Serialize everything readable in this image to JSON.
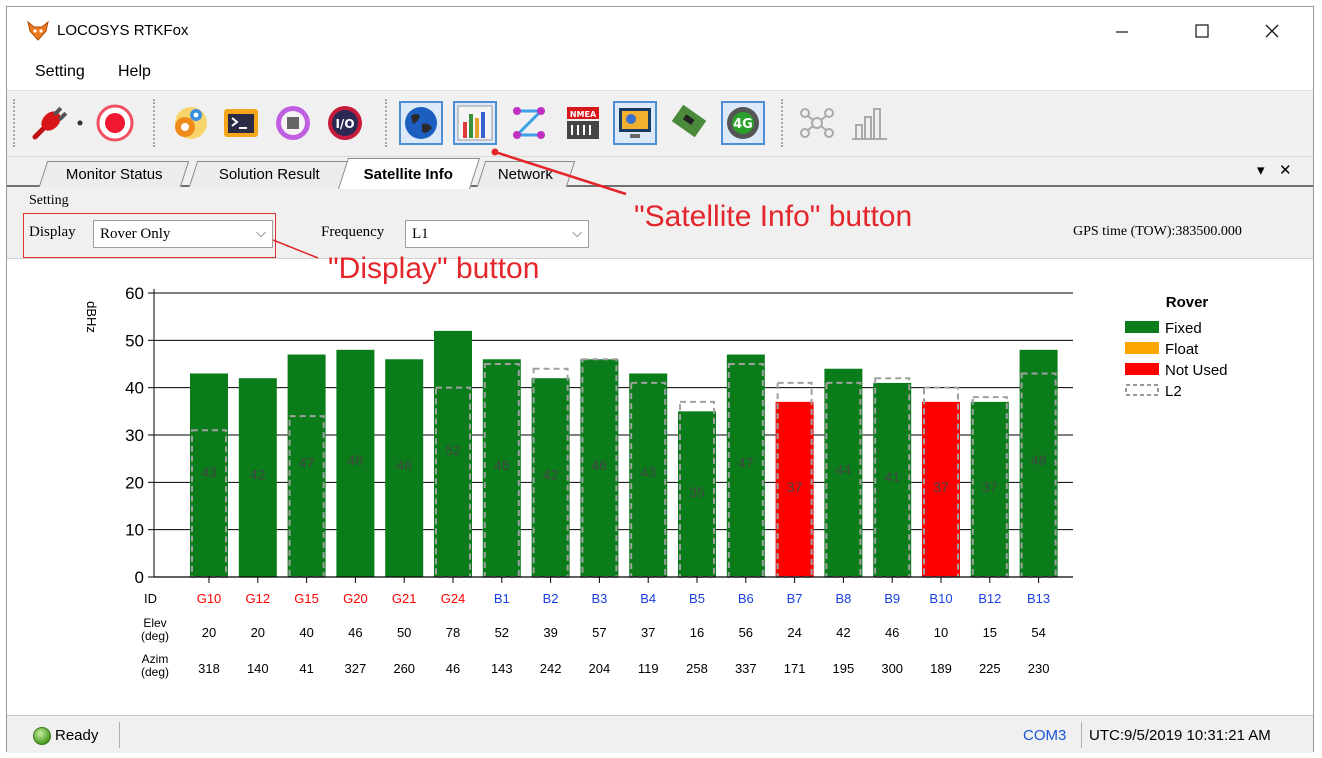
{
  "window": {
    "title": "LOCOSYS RTKFox"
  },
  "menu": [
    "Setting",
    "Help"
  ],
  "tabs": [
    {
      "label": "Monitor Status",
      "active": false
    },
    {
      "label": "Solution Result",
      "active": false
    },
    {
      "label": "Satellite Info",
      "active": true
    },
    {
      "label": "Network",
      "active": false
    }
  ],
  "setting": {
    "group_label": "Setting",
    "display_label": "Display",
    "display_value": "Rover Only",
    "frequency_label": "Frequency",
    "frequency_value": "L1",
    "gps_time": "GPS time (TOW):383500.000"
  },
  "annotations": {
    "satellite_info": "\"Satellite Info\" button",
    "display": "\"Display\" button"
  },
  "status": {
    "ready": "Ready",
    "com": "COM3",
    "utc": "UTC:9/5/2019 10:31:21 AM"
  },
  "colors": {
    "fixed": "#0a7d1a",
    "float": "#ffa500",
    "not_used": "#ff0000",
    "gps_id": "#ff0000",
    "bds_id": "#1a3fe0",
    "annotation": "#e4262b"
  },
  "chart_data": {
    "type": "bar",
    "ylabel": "dBHz",
    "ylim": [
      0,
      60
    ],
    "yticks": [
      0,
      10,
      20,
      30,
      40,
      50,
      60
    ],
    "grid": true,
    "legend": {
      "title": "Rover",
      "placement": "right",
      "entries": [
        "Fixed",
        "Float",
        "Not Used",
        "L2"
      ]
    },
    "row_labels": {
      "id": "ID",
      "elev": "Elev\n(deg)",
      "azim": "Azim\n(deg)"
    },
    "satellites": [
      {
        "id": "G10",
        "system": "GPS",
        "snr": 43,
        "l2": 31,
        "status": "Fixed",
        "elev": 20,
        "azim": 318
      },
      {
        "id": "G12",
        "system": "GPS",
        "snr": 42,
        "l2": null,
        "status": "Fixed",
        "elev": 20,
        "azim": 140
      },
      {
        "id": "G15",
        "system": "GPS",
        "snr": 47,
        "l2": 34,
        "status": "Fixed",
        "elev": 40,
        "azim": 41
      },
      {
        "id": "G20",
        "system": "GPS",
        "snr": 48,
        "l2": null,
        "status": "Fixed",
        "elev": 46,
        "azim": 327
      },
      {
        "id": "G21",
        "system": "GPS",
        "snr": 46,
        "l2": null,
        "status": "Fixed",
        "elev": 50,
        "azim": 260
      },
      {
        "id": "G24",
        "system": "GPS",
        "snr": 52,
        "l2": 40,
        "status": "Fixed",
        "elev": 78,
        "azim": 46
      },
      {
        "id": "B1",
        "system": "BDS",
        "snr": 46,
        "l2": 45,
        "status": "Fixed",
        "elev": 52,
        "azim": 143
      },
      {
        "id": "B2",
        "system": "BDS",
        "snr": 42,
        "l2": 44,
        "status": "Fixed",
        "elev": 39,
        "azim": 242
      },
      {
        "id": "B3",
        "system": "BDS",
        "snr": 46,
        "l2": 46,
        "status": "Fixed",
        "elev": 57,
        "azim": 204
      },
      {
        "id": "B4",
        "system": "BDS",
        "snr": 43,
        "l2": 41,
        "status": "Fixed",
        "elev": 37,
        "azim": 119
      },
      {
        "id": "B5",
        "system": "BDS",
        "snr": 35,
        "l2": 37,
        "status": "Fixed",
        "elev": 16,
        "azim": 258
      },
      {
        "id": "B6",
        "system": "BDS",
        "snr": 47,
        "l2": 45,
        "status": "Fixed",
        "elev": 56,
        "azim": 337
      },
      {
        "id": "B7",
        "system": "BDS",
        "snr": 37,
        "l2": 41,
        "status": "Not Used",
        "elev": 24,
        "azim": 171
      },
      {
        "id": "B8",
        "system": "BDS",
        "snr": 44,
        "l2": 41,
        "status": "Fixed",
        "elev": 42,
        "azim": 195
      },
      {
        "id": "B9",
        "system": "BDS",
        "snr": 41,
        "l2": 42,
        "status": "Fixed",
        "elev": 46,
        "azim": 300
      },
      {
        "id": "B10",
        "system": "BDS",
        "snr": 37,
        "l2": 40,
        "status": "Not Used",
        "elev": 10,
        "azim": 189
      },
      {
        "id": "B12",
        "system": "BDS",
        "snr": 37,
        "l2": 38,
        "status": "Fixed",
        "elev": 15,
        "azim": 225
      },
      {
        "id": "B13",
        "system": "BDS",
        "snr": 48,
        "l2": 43,
        "status": "Fixed",
        "elev": 54,
        "azim": 230
      }
    ]
  }
}
